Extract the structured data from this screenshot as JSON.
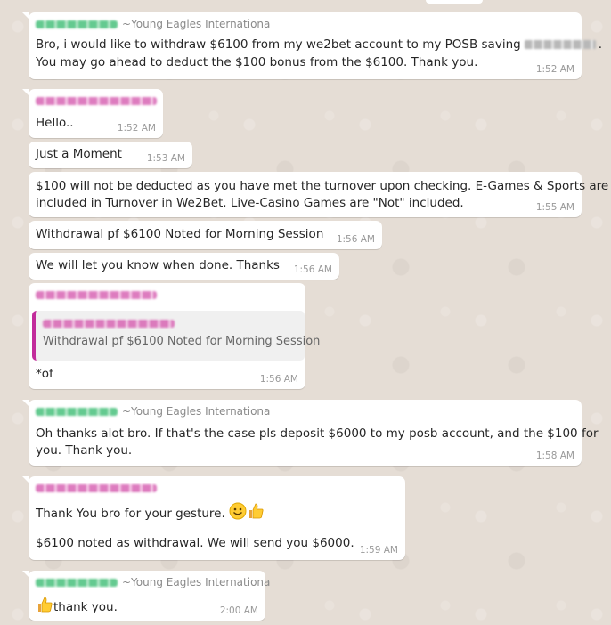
{
  "colors": {
    "chat_background": "#e5ddd5",
    "bubble": "#ffffff",
    "sender_blur_green": "#49c17d",
    "sender_blur_pink": "#d866b4",
    "quote_bar": "#c22c9b",
    "timestamp": "#999999"
  },
  "messages": [
    {
      "sender_org": "~Young Eagles Internationa",
      "line1_before": "Bro, i would like to withdraw $6100 from my we2bet account to my POSB saving",
      "line1_after": ".",
      "line2": "You may go ahead to deduct the $100 bonus from the $6100. Thank you.",
      "time": "1:52 AM"
    },
    {
      "line1": "Hello..",
      "time": "1:52 AM"
    },
    {
      "line1": "Just a Moment",
      "time": "1:53 AM"
    },
    {
      "line1": "$100 will not be deducted as you have met the turnover upon checking. E-Games & Sports are",
      "line2": "included in Turnover in We2Bet. Live-Casino Games are \"Not\" included.",
      "time": "1:55 AM"
    },
    {
      "line1": "Withdrawal pf $6100 Noted for Morning Session",
      "time": "1:56 AM"
    },
    {
      "line1": "We will let you know when done. Thanks",
      "time": "1:56 AM"
    },
    {
      "quoted_text": "Withdrawal pf $6100 Noted for Morning Session",
      "line1": "*of",
      "time": "1:56 AM"
    },
    {
      "sender_org": "~Young Eagles Internationa",
      "line1": "Oh thanks alot bro. If that's the case pls deposit $6000 to my posb account, and the $100 for",
      "line2": "you. Thank you.",
      "time": "1:58 AM"
    },
    {
      "line1": "Thank You bro for your gesture.",
      "line2": "$6100 noted as withdrawal. We will send you $6000.",
      "time": "1:59 AM"
    },
    {
      "sender_org": "~Young Eagles Internationa",
      "line1": "thank you.",
      "time": "2:00 AM"
    }
  ]
}
